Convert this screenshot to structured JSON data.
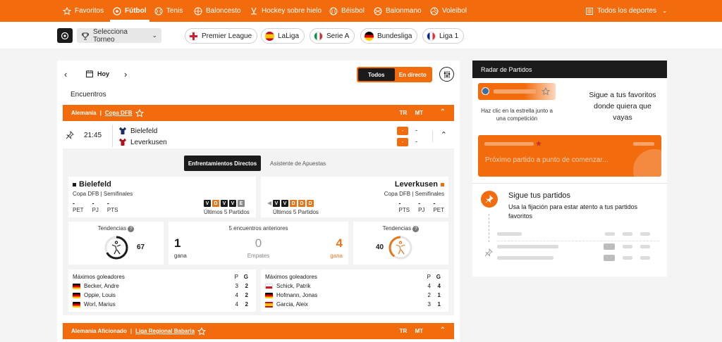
{
  "nav": {
    "items": [
      {
        "label": "Favoritos",
        "icon": "star-icon"
      },
      {
        "label": "Fútbol",
        "icon": "soccer-ball-icon"
      },
      {
        "label": "Tenis",
        "icon": "tennis-ball-icon"
      },
      {
        "label": "Baloncesto",
        "icon": "basketball-icon"
      },
      {
        "label": "Hockey sobre hielo",
        "icon": "hockey-icon"
      },
      {
        "label": "Béisbol",
        "icon": "baseball-icon"
      },
      {
        "label": "Balonmano",
        "icon": "handball-icon"
      },
      {
        "label": "Voleibol",
        "icon": "volleyball-icon"
      }
    ],
    "all_sports": "Todos los deportes",
    "active": "Fútbol"
  },
  "subbar": {
    "select_tournament": "Selecciona Torneo",
    "leagues": [
      "Premier League",
      "LaLiga",
      "Serie A",
      "Bundesliga",
      "Liga 1"
    ]
  },
  "datebar": {
    "day": "Hoy",
    "toggle_all": "Todos",
    "toggle_live": "En directo"
  },
  "encuentros": "Encuentros",
  "league1": {
    "country": "Alemania",
    "competition": "Copa DFB",
    "col_tr": "TR",
    "col_mt": "MT"
  },
  "match": {
    "time": "21:45",
    "home": "Bielefeld",
    "away": "Leverkusen",
    "home_score": "-",
    "away_score": "-",
    "home_box": "-",
    "away_box": "-"
  },
  "detail": {
    "tab_h2h": "Enfrentamientos Directos",
    "tab_betting": "Asistente de Apuestas",
    "home": {
      "name": "Bielefeld",
      "sub": "Copa DFB | Semifinales",
      "stats": [
        {
          "val": "-",
          "lbl": "PET"
        },
        {
          "val": "-",
          "lbl": "PJ"
        },
        {
          "val": "-",
          "lbl": "PTS"
        }
      ],
      "form": [
        "V",
        "D",
        "V",
        "V",
        "E"
      ],
      "form_label": "Últimos 5 Partidos"
    },
    "away": {
      "name": "Leverkusen",
      "sub": "Copa DFB | Semifinales",
      "stats": [
        {
          "val": "-",
          "lbl": "PTS"
        },
        {
          "val": "-",
          "lbl": "PJ"
        },
        {
          "val": "-",
          "lbl": "PET"
        }
      ],
      "form": [
        "V",
        "V",
        "D",
        "D",
        "D"
      ],
      "form_label": "Últimos 5 Partidos"
    },
    "trend_label": "Tendencias",
    "home_trend": "67",
    "home_trend_pct": 67,
    "away_trend": "40",
    "away_trend_pct": 40,
    "h2h_title": "5 encuentros anteriores",
    "h2h_home": "1",
    "h2h_draw": "0",
    "h2h_away": "4",
    "h2h_win": "gana",
    "h2h_draw_lbl": "Empates",
    "scorers_title": "Máximos goleadores",
    "col_p": "P",
    "col_g": "G",
    "home_scorers": [
      {
        "name": "Becker, Andre",
        "p": "3",
        "g": "2",
        "flag": "de"
      },
      {
        "name": "Oppie, Louis",
        "p": "4",
        "g": "2",
        "flag": "de"
      },
      {
        "name": "Worl, Marius",
        "p": "4",
        "g": "2",
        "flag": "de"
      }
    ],
    "away_scorers": [
      {
        "name": "Schick, Patrik",
        "p": "4",
        "g": "4",
        "flag": "cz"
      },
      {
        "name": "Hofmann, Jonas",
        "p": "2",
        "g": "1",
        "flag": "de"
      },
      {
        "name": "Garcia, Aleix",
        "p": "3",
        "g": "1",
        "flag": "es"
      }
    ]
  },
  "league2": {
    "country": "Alemania Aficionado",
    "competition": "Liga Regional Babaria",
    "col_tr": "TR",
    "col_mt": "MT"
  },
  "radar": {
    "title": "Radar de Partidos",
    "hint": "Haz clic en la estrella junto a una competición",
    "headline": "Sigue a tus favoritos donde quiera que vayas",
    "next": "Próximo partido a punto de comenzar...",
    "follow_title": "Sigue tus partidos",
    "follow_text": "Usa la fijación para estar atento a tus partidos favoritos"
  },
  "colors": {
    "accent": "#f26c0d",
    "dark": "#1b1b1b"
  }
}
